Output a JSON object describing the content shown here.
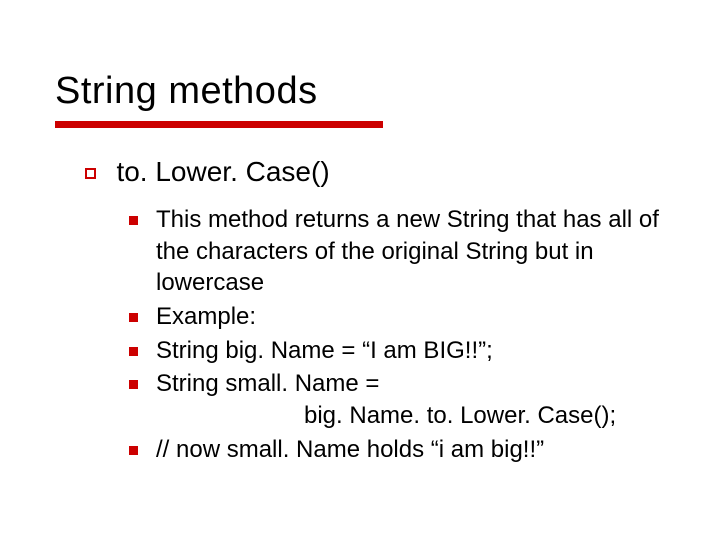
{
  "title": "String methods",
  "level1": "to. Lower. Case()",
  "items": [
    "This method returns a new String that has all of the characters of the original String but in lowercase",
    "Example:",
    "String big. Name = “I am BIG!!”;",
    "String small. Name =",
    "big. Name. to. Lower. Case();",
    "// now small. Name holds “i am big!!”"
  ]
}
